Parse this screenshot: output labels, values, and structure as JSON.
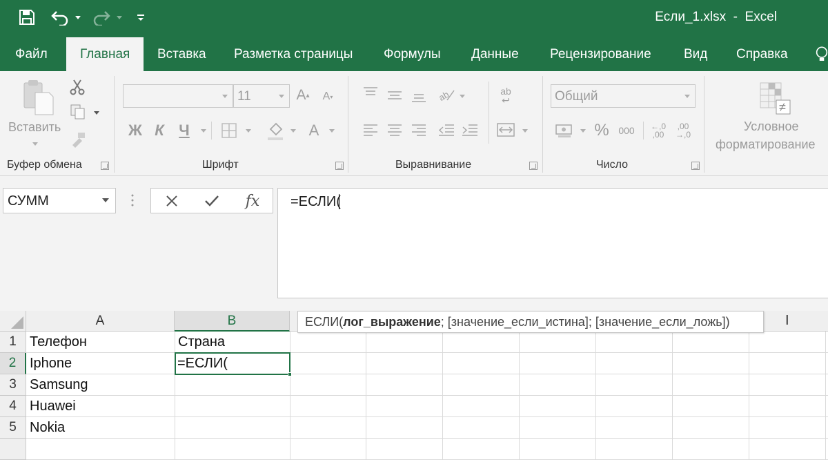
{
  "window": {
    "title": "Если_1.xlsx  -  Excel"
  },
  "tabs": [
    "Файл",
    "Главная",
    "Вставка",
    "Разметка страницы",
    "Формулы",
    "Данные",
    "Рецензирование",
    "Вид",
    "Справка"
  ],
  "ribbon": {
    "clipboard": {
      "paste_label": "Вставить",
      "group_label": "Буфер обмена"
    },
    "font": {
      "size": "11",
      "bold": "Ж",
      "italic": "К",
      "underline": "Ч",
      "font_color": "А",
      "group_label": "Шрифт"
    },
    "alignment": {
      "group_label": "Выравнивание",
      "wrap_glyph": "ab"
    },
    "number": {
      "format": "Общий",
      "percent": "%",
      "thousands": "000",
      "inc_decimal": "←,0\n,00",
      "dec_decimal": ",00\n→,0",
      "group_label": "Число"
    },
    "styles": {
      "conditional_label_1": "Условное",
      "conditional_label_2": "форматирование"
    }
  },
  "formula_bar": {
    "name_box": "СУММ",
    "fx_label": "fx",
    "formula": "=ЕСЛИ("
  },
  "tooltip": {
    "func": "ЕСЛИ(",
    "arg_bold": "лог_выражение",
    "rest": "; [значение_если_истина]; [значение_если_ложь])"
  },
  "sheet": {
    "columns": [
      "A",
      "B",
      "I"
    ],
    "rows": [
      "1",
      "2",
      "3",
      "4",
      "5"
    ],
    "cells": {
      "A1": "Телефон",
      "B1": "Страна",
      "A2": "Iphone",
      "B2": "=ЕСЛИ(",
      "A3": "Samsung",
      "A4": "Huawei",
      "A5": "Nokia"
    }
  },
  "colors": {
    "brand": "#217346",
    "ribbon_bg": "#f3f3f3"
  }
}
